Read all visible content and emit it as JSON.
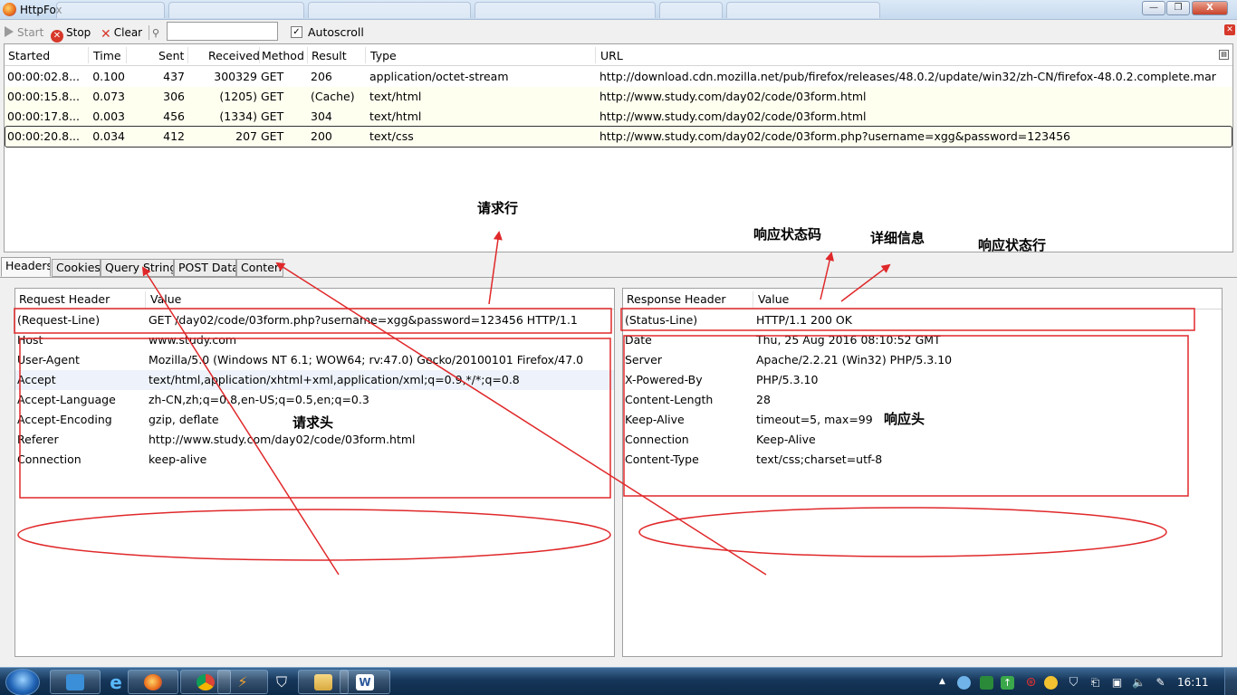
{
  "window": {
    "title": "HttpFox",
    "buttons": {
      "minimize": "—",
      "restore": "❐",
      "close": "X"
    }
  },
  "toolbar": {
    "start_label": "Start",
    "stop_label": "Stop",
    "clear_label": "Clear",
    "filter_value": "",
    "autoscroll_label": "Autoscroll",
    "autoscroll_checked": true
  },
  "request_list": {
    "columns": [
      "Started",
      "Time",
      "Sent",
      "Received",
      "Method",
      "Result",
      "Type",
      "URL"
    ],
    "rows": [
      {
        "started": "00:00:02.8...",
        "time": "0.100",
        "sent": "437",
        "received": "300329",
        "method": "GET",
        "result": "206",
        "type": "application/octet-stream",
        "url": "http://download.cdn.mozilla.net/pub/firefox/releases/48.0.2/update/win32/zh-CN/firefox-48.0.2.complete.mar"
      },
      {
        "started": "00:00:15.8...",
        "time": "0.073",
        "sent": "306",
        "received": "(1205)",
        "method": "GET",
        "result": "(Cache)",
        "type": "text/html",
        "url": "http://www.study.com/day02/code/03form.html"
      },
      {
        "started": "00:00:17.8...",
        "time": "0.003",
        "sent": "456",
        "received": "(1334)",
        "method": "GET",
        "result": "304",
        "type": "text/html",
        "url": "http://www.study.com/day02/code/03form.html"
      },
      {
        "started": "00:00:20.8...",
        "time": "0.034",
        "sent": "412",
        "received": "207",
        "method": "GET",
        "result": "200",
        "type": "text/css",
        "url": "http://www.study.com/day02/code/03form.php?username=xgg&password=123456"
      }
    ]
  },
  "tabs": [
    "Headers",
    "Cookies",
    "Query String",
    "POST Data",
    "Content"
  ],
  "request_headers": {
    "col_name": "Request Header",
    "col_value": "Value",
    "rows": [
      {
        "name": "(Request-Line)",
        "value": "GET /day02/code/03form.php?username=xgg&password=123456 HTTP/1.1"
      },
      {
        "name": "Host",
        "value": "www.study.com"
      },
      {
        "name": "User-Agent",
        "value": "Mozilla/5.0 (Windows NT 6.1; WOW64; rv:47.0) Gecko/20100101 Firefox/47.0"
      },
      {
        "name": "Accept",
        "value": "text/html,application/xhtml+xml,application/xml;q=0.9,*/*;q=0.8"
      },
      {
        "name": "Accept-Language",
        "value": "zh-CN,zh;q=0.8,en-US;q=0.5,en;q=0.3"
      },
      {
        "name": "Accept-Encoding",
        "value": "gzip, deflate"
      },
      {
        "name": "Referer",
        "value": "http://www.study.com/day02/code/03form.html"
      },
      {
        "name": "Connection",
        "value": "keep-alive"
      }
    ]
  },
  "response_headers": {
    "col_name": "Response Header",
    "col_value": "Value",
    "rows": [
      {
        "name": "(Status-Line)",
        "value": "HTTP/1.1 200 OK"
      },
      {
        "name": "Date",
        "value": "Thu, 25 Aug 2016 08:10:52 GMT"
      },
      {
        "name": "Server",
        "value": "Apache/2.2.21 (Win32) PHP/5.3.10"
      },
      {
        "name": "X-Powered-By",
        "value": "PHP/5.3.10"
      },
      {
        "name": "Content-Length",
        "value": "28"
      },
      {
        "name": "Keep-Alive",
        "value": "timeout=5, max=99"
      },
      {
        "name": "Connection",
        "value": "Keep-Alive"
      },
      {
        "name": "Content-Type",
        "value": "text/css;charset=utf-8"
      }
    ]
  },
  "annotations": {
    "request_line": "请求行",
    "request_header": "请求头",
    "status_code": "响应状态码",
    "detail_info": "详细信息",
    "status_line": "响应状态行",
    "response_header": "响应头"
  },
  "taskbar": {
    "apps": [
      "user-accounts",
      "internet-explorer",
      "firefox",
      "chrome",
      "editor",
      "security",
      "file-explorer",
      "word"
    ],
    "clock": "16:11"
  },
  "colors": {
    "annotation_red": "#e0282a",
    "cached_row_bg": "#fffff0",
    "taskbar_bg": "#17375a"
  }
}
